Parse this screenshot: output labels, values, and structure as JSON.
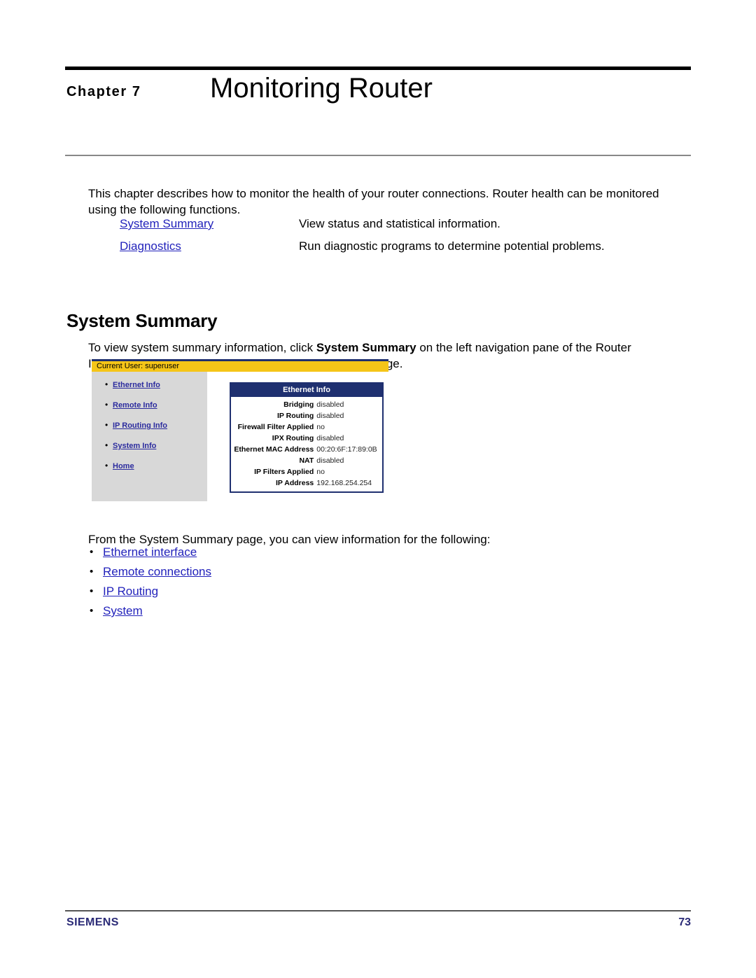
{
  "page": {
    "chapter_label": "Chapter 7",
    "chapter_title": "Monitoring Router",
    "intro": "This chapter describes how to monitor the health of your router connections. Router health can be monitored using the following functions."
  },
  "functions": [
    {
      "link": "System Summary",
      "description": "View status and statistical information."
    },
    {
      "link": "Diagnostics",
      "description": "Run diagnostic programs to determine potential problems."
    }
  ],
  "section": {
    "heading": "System Summary",
    "body_part1": "To view system summary information, click ",
    "body_bold": "System Summary",
    "body_part2": " on the left navigation pane of the Router Information page. This displays the System Summary page."
  },
  "screenshot": {
    "user_bar": "Current User: superuser",
    "nav_items": [
      "Ethernet Info",
      "Remote Info",
      "IP Routing Info",
      "System Info",
      "Home"
    ],
    "panel_title": "Ethernet Info",
    "panel_rows": [
      {
        "label": "Bridging",
        "value": "disabled"
      },
      {
        "label": "IP Routing",
        "value": "disabled"
      },
      {
        "label": "Firewall Filter Applied",
        "value": "no"
      },
      {
        "label": "IPX Routing",
        "value": "disabled"
      },
      {
        "label": "Ethernet MAC Address",
        "value": "00:20:6F:17:89:0B"
      },
      {
        "label": "NAT",
        "value": "disabled"
      },
      {
        "label": "IP Filters Applied",
        "value": "no"
      },
      {
        "label": "IP Address",
        "value": "192.168.254.254"
      }
    ],
    "colors": {
      "title_bar": "#1f3070",
      "user_bar": "#f5c518",
      "nav_background": "#d8d8d8",
      "link": "#2b2b9e"
    }
  },
  "closing": {
    "lead_in": "From the System Summary page, you can view information for the following:",
    "items": [
      "Ethernet interface",
      "Remote connections",
      "IP Routing",
      "System"
    ]
  },
  "footer": {
    "brand": "SIEMENS",
    "page_number": "73"
  }
}
